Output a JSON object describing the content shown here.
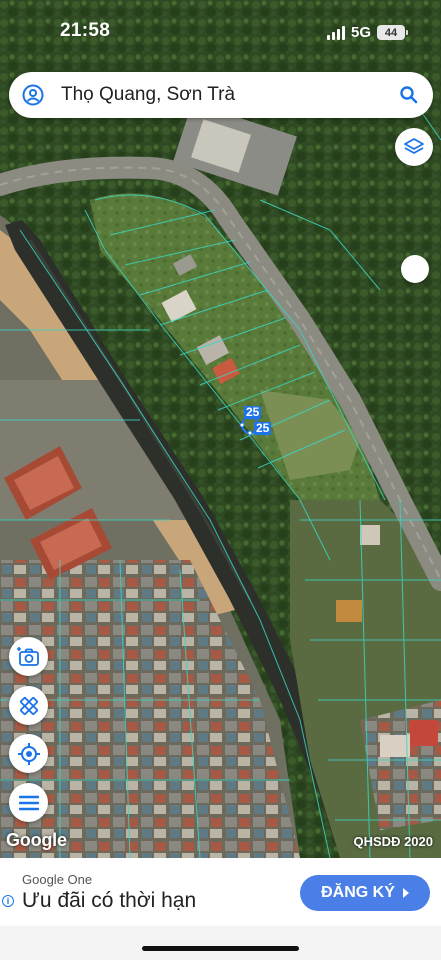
{
  "status_bar": {
    "time": "21:58",
    "network": "5G",
    "battery": "44"
  },
  "search": {
    "query": "Thọ Quang, Sơn Trà"
  },
  "map": {
    "parcel_labels": [
      "25",
      "25"
    ],
    "attribution": "Google",
    "credit": "QHSDĐ 2020",
    "overlay_color": "#3ad6c0"
  },
  "controls": {
    "icons": [
      "camera-icon",
      "ruler-icon",
      "my-location-icon",
      "menu-icon",
      "layers-icon"
    ]
  },
  "ad": {
    "brand": "Google One",
    "headline": "Ưu đãi có thời hạn",
    "cta": "ĐĂNG KÝ",
    "accent": "#4a7fe8"
  }
}
